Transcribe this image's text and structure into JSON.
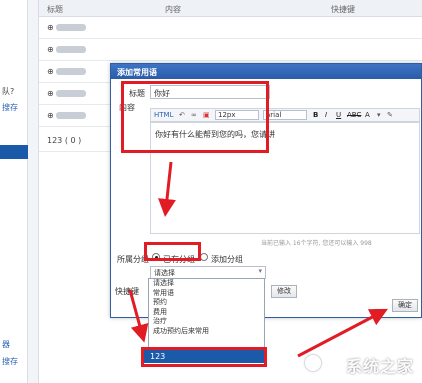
{
  "leftbar": {
    "labels": [
      "队?",
      "搜存",
      "器",
      "搜存"
    ]
  },
  "list": {
    "headers": {
      "title": "标题",
      "content": "内容",
      "shortcut": "快捷键"
    },
    "rows": [
      "",
      "",
      "",
      "",
      "123 ( 0 )"
    ]
  },
  "dialog": {
    "title": "添加常用语",
    "title_label": "标题",
    "title_value": "你好",
    "content_label": "内容",
    "font_size": "12px",
    "font_family": "arial",
    "editor_text": "你好有什么能帮到您的吗，您请讲",
    "counter_text": "当前已输入 16个字符, 您还可以输入 998",
    "group_label": "所属分组",
    "existing_group": "已有分组",
    "add_group": "添加分组",
    "select_value": "请选择",
    "shortcut_label": "快捷键",
    "modify_button": "修改",
    "confirm_button": "确定"
  },
  "dropdown": {
    "options": [
      "请选择",
      "常用语",
      "预约",
      "费用",
      "治疗",
      "成功预约后来常用"
    ],
    "highlighted": "123"
  },
  "toolbar": {
    "html_label": "HTML",
    "font_color_label": "A",
    "bold": "B",
    "italic": "I",
    "underline": "U",
    "strike": "ABC"
  },
  "watermark": "系统之家",
  "colors": {
    "accent": "#1a5aa8",
    "annotation": "#e11c24"
  }
}
